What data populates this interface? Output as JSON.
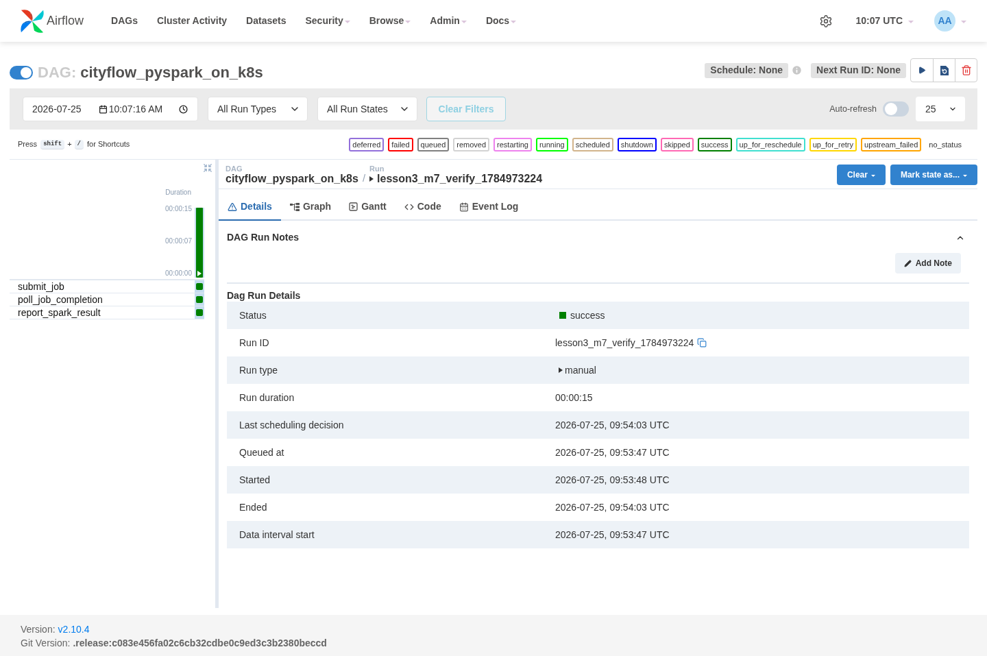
{
  "navbar": {
    "brand": "Airflow",
    "items": [
      {
        "label": "DAGs",
        "has_menu": false
      },
      {
        "label": "Cluster Activity",
        "has_menu": false
      },
      {
        "label": "Datasets",
        "has_menu": false
      },
      {
        "label": "Security",
        "has_menu": true
      },
      {
        "label": "Browse",
        "has_menu": true
      },
      {
        "label": "Admin",
        "has_menu": true
      },
      {
        "label": "Docs",
        "has_menu": true
      }
    ],
    "clock": "10:07 UTC",
    "avatar": "AA"
  },
  "dag_header": {
    "active": true,
    "prefix": "DAG:",
    "name": "cityflow_pyspark_on_k8s",
    "schedule": "Schedule: None",
    "next_run": "Next Run ID: None"
  },
  "filters": {
    "date": "2026-07-25",
    "time": "10:07:16 AM",
    "run_type": "All Run Types",
    "run_state": "All Run States",
    "clear_filters": {
      "label": "Clear Filters",
      "disabled": true
    },
    "auto_refresh": {
      "label": "Auto-refresh",
      "on": false
    },
    "page_size": "25"
  },
  "shortcuts": {
    "prefix": "Press",
    "keys": [
      "shift",
      "/"
    ],
    "joiner": "+",
    "suffix": "for Shortcuts"
  },
  "state_legend": [
    {
      "label": "deferred",
      "color": "#9370db"
    },
    {
      "label": "failed",
      "color": "#ff0000"
    },
    {
      "label": "queued",
      "color": "#808080"
    },
    {
      "label": "removed",
      "color": "#d3d3d3"
    },
    {
      "label": "restarting",
      "color": "#ee82ee"
    },
    {
      "label": "running",
      "color": "#00ff00"
    },
    {
      "label": "scheduled",
      "color": "#d2b48c"
    },
    {
      "label": "shutdown",
      "color": "#0000ff"
    },
    {
      "label": "skipped",
      "color": "#ff69b4"
    },
    {
      "label": "success",
      "color": "#008000"
    },
    {
      "label": "up_for_reschedule",
      "color": "#40e0d0"
    },
    {
      "label": "up_for_retry",
      "color": "#ffd700"
    },
    {
      "label": "upstream_failed",
      "color": "#ffa500"
    },
    {
      "label": "no_status"
    }
  ],
  "grid": {
    "duration_label": "Duration",
    "ticks": [
      "00:00:15",
      "00:00:07",
      "00:00:00"
    ],
    "runs": [
      {
        "level": 1,
        "color": "#008000"
      }
    ],
    "tasks": [
      {
        "name": "submit_job",
        "color": "#008000"
      },
      {
        "name": "poll_job_completion",
        "color": "#008000"
      },
      {
        "name": "report_spark_result",
        "color": "#008000"
      }
    ]
  },
  "breadcrumb": {
    "dag_label": "DAG",
    "dag": "cityflow_pyspark_on_k8s",
    "separator": "/",
    "run_label": "Run",
    "run": "lesson3_m7_verify_1784973224"
  },
  "actions": [
    "Clear",
    "Mark state as..."
  ],
  "tabs": [
    {
      "label": "Details",
      "selected": true
    },
    {
      "label": "Graph",
      "selected": false
    },
    {
      "label": "Gantt",
      "selected": false
    },
    {
      "label": "Code",
      "selected": false
    },
    {
      "label": "Event Log",
      "selected": false
    }
  ],
  "notes": {
    "title": "DAG Run Notes",
    "expanded": true,
    "add_note": "Add Note"
  },
  "details": {
    "title": "Dag Run Details",
    "rows": [
      {
        "label": "Status",
        "value": "success",
        "kind": "status",
        "color": "#008000"
      },
      {
        "label": "Run ID",
        "value": "lesson3_m7_verify_1784973224",
        "kind": "copyable"
      },
      {
        "label": "Run type",
        "value": "manual",
        "kind": "run_type"
      },
      {
        "label": "Run duration",
        "value": "00:00:15",
        "kind": "text"
      },
      {
        "label": "Last scheduling decision",
        "value": "2026-07-25, 09:54:03 UTC",
        "kind": "text"
      },
      {
        "label": "Queued at",
        "value": "2026-07-25, 09:53:47 UTC",
        "kind": "text"
      },
      {
        "label": "Started",
        "value": "2026-07-25, 09:53:48 UTC",
        "kind": "text"
      },
      {
        "label": "Ended",
        "value": "2026-07-25, 09:54:03 UTC",
        "kind": "text"
      },
      {
        "label": "Data interval start",
        "value": "2026-07-25, 09:53:47 UTC",
        "kind": "text"
      }
    ]
  },
  "footer": {
    "version_label": "Version:",
    "version": "v2.10.4",
    "git_label": "Git Version:",
    "git": ".release:c083e456fa02c6cb32cdbe0c9ed3c3b2380beccd"
  }
}
